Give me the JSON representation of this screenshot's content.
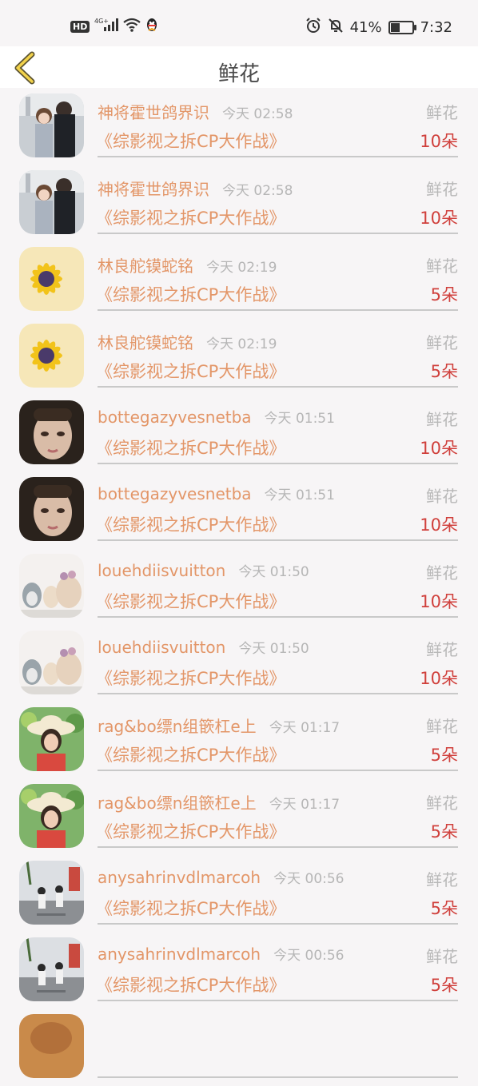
{
  "status_bar": {
    "hd": "HD",
    "network": "4G+",
    "battery_pct": "41%",
    "battery_level": 0.41,
    "time": "7:32"
  },
  "header": {
    "title": "鲜花"
  },
  "list": [
    {
      "name": "神将霍世鸽界识",
      "time": "今天 02:58",
      "type": "鲜花",
      "show": "《综影视之拆CP大作战》",
      "count": "10朵",
      "avatar": "couple-avatar"
    },
    {
      "name": "神将霍世鸽界识",
      "time": "今天 02:58",
      "type": "鲜花",
      "show": "《综影视之拆CP大作战》",
      "count": "10朵",
      "avatar": "couple-avatar"
    },
    {
      "name": "林良舵镆蛇铭",
      "time": "今天 02:19",
      "type": "鲜花",
      "show": "《综影视之拆CP大作战》",
      "count": "5朵",
      "avatar": "sunflower-avatar"
    },
    {
      "name": "林良舵镆蛇铭",
      "time": "今天 02:19",
      "type": "鲜花",
      "show": "《综影视之拆CP大作战》",
      "count": "5朵",
      "avatar": "sunflower-avatar"
    },
    {
      "name": "bottegazyvesnetba",
      "time": "今天 01:51",
      "type": "鲜花",
      "show": "《综影视之拆CP大作战》",
      "count": "10朵",
      "avatar": "portrait-avatar"
    },
    {
      "name": "bottegazyvesnetba",
      "time": "今天 01:51",
      "type": "鲜花",
      "show": "《综影视之拆CP大作战》",
      "count": "10朵",
      "avatar": "portrait-avatar"
    },
    {
      "name": "louehdiisvuitton",
      "time": "今天 01:50",
      "type": "鲜花",
      "show": "《综影视之拆CP大作战》",
      "count": "10朵",
      "avatar": "plush-toys-avatar"
    },
    {
      "name": "louehdiisvuitton",
      "time": "今天 01:50",
      "type": "鲜花",
      "show": "《综影视之拆CP大作战》",
      "count": "10朵",
      "avatar": "plush-toys-avatar"
    },
    {
      "name": "rag&bo缥n组篏杠e上",
      "time": "今天 01:17",
      "type": "鲜花",
      "show": "《综影视之拆CP大作战》",
      "count": "5朵",
      "avatar": "girl-hat-avatar"
    },
    {
      "name": "rag&bo缥n组篏杠e上",
      "time": "今天 01:17",
      "type": "鲜花",
      "show": "《综影视之拆CP大作战》",
      "count": "5朵",
      "avatar": "girl-hat-avatar"
    },
    {
      "name": "anysahrinvdlmarcoh",
      "time": "今天 00:56",
      "type": "鲜花",
      "show": "《综影视之拆CP大作战》",
      "count": "5朵",
      "avatar": "street-couple-avatar"
    },
    {
      "name": "anysahrinvdlmarcoh",
      "time": "今天 00:56",
      "type": "鲜花",
      "show": "《综影视之拆CP大作战》",
      "count": "5朵",
      "avatar": "street-couple-avatar"
    },
    {
      "name": "",
      "time": "",
      "type": "",
      "show": "",
      "count": "",
      "avatar": "partial-avatar"
    }
  ]
}
